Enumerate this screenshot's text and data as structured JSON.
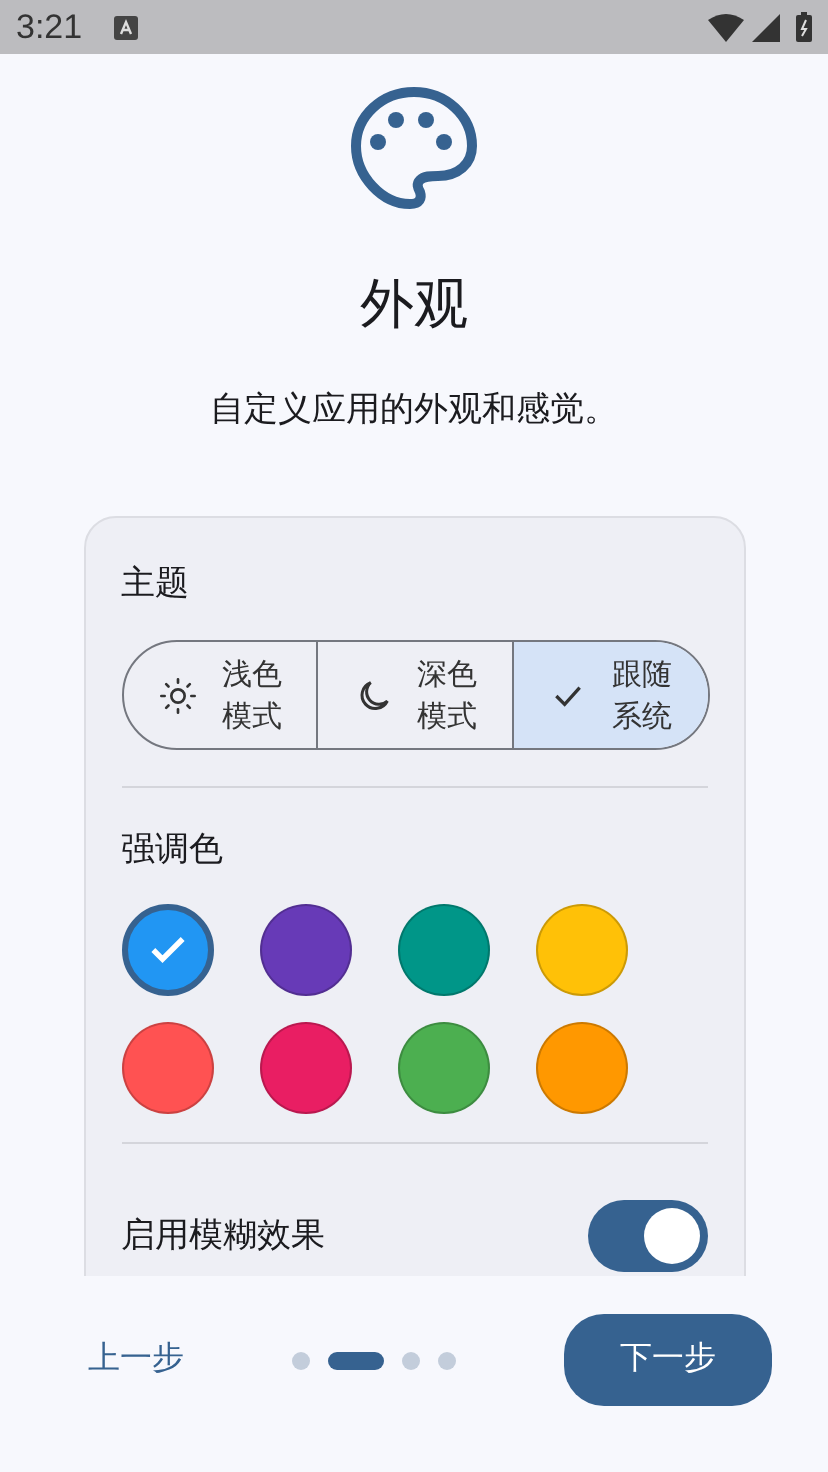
{
  "status_bar": {
    "time": "3:21"
  },
  "header": {
    "title": "外观",
    "subtitle": "自定义应用的外观和感觉。"
  },
  "theme": {
    "label": "主题",
    "options": [
      {
        "kind": "light",
        "label": "浅色模式",
        "selected": false
      },
      {
        "kind": "dark",
        "label": "深色模式",
        "selected": false
      },
      {
        "kind": "system",
        "label": "跟随系统",
        "selected": true
      }
    ]
  },
  "accent": {
    "label": "强调色",
    "colors": [
      {
        "color": "#2196f3",
        "selected": true
      },
      {
        "color": "#673ab7",
        "selected": false
      },
      {
        "color": "#009688",
        "selected": false
      },
      {
        "color": "#ffc107",
        "selected": false
      },
      {
        "color": "#ff5252",
        "selected": false
      },
      {
        "color": "#e91e63",
        "selected": false
      },
      {
        "color": "#4caf50",
        "selected": false
      },
      {
        "color": "#ff9800",
        "selected": false
      }
    ]
  },
  "blur": {
    "label": "启用模糊效果",
    "on": true
  },
  "footer": {
    "back": "上一步",
    "next": "下一步",
    "pages": [
      {
        "selected": false
      },
      {
        "selected": true
      },
      {
        "selected": false
      },
      {
        "selected": false
      }
    ]
  }
}
